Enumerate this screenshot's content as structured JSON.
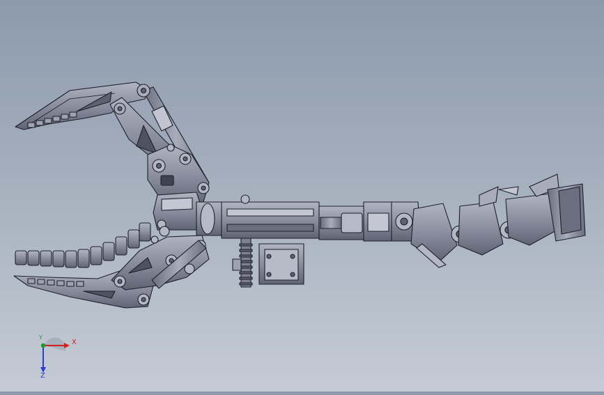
{
  "viewport": {
    "model": "robotic-gripper-arm-assembly",
    "background_top": "#8c9aac",
    "background_bottom": "#c5cbd5",
    "part_fill": "#8a8e9e",
    "part_light": "#a9adbb",
    "part_dark": "#5d6171",
    "edge_color": "#1d1f2a"
  },
  "triad": {
    "x_label": "X",
    "y_label": "Y",
    "z_label": "Z",
    "x_color": "#d21f1f",
    "y_color": "#1f9a2a",
    "z_color": "#2a3fd0"
  }
}
